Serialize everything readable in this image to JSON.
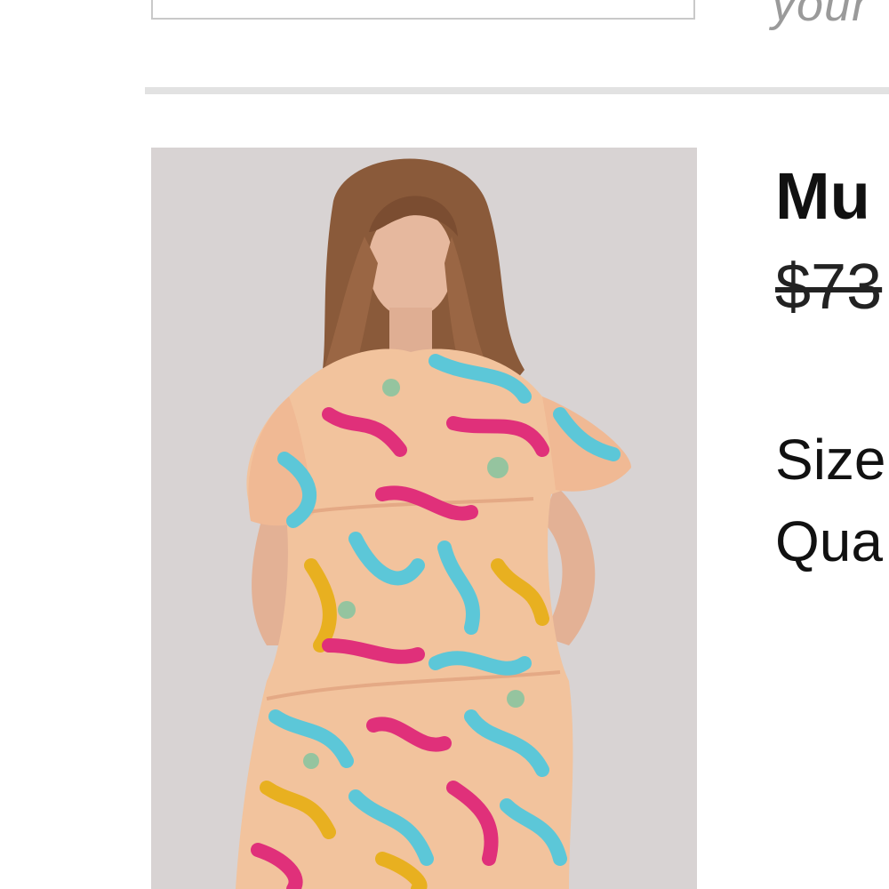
{
  "search": {
    "hint": "your"
  },
  "product": {
    "image_alt": "Model wearing a multicolor tropical print tiered dress with puff sleeves",
    "title": "Mu",
    "price": "$73",
    "size_label": "Size",
    "quantity_label": "Qua"
  },
  "colors": {
    "divider": "#e2e2e2",
    "image_background": "#d9d4d4",
    "hint_text": "#9a9a9a",
    "text": "#111111"
  }
}
